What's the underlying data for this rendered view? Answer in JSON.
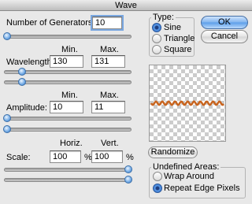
{
  "window": {
    "title": "Wave"
  },
  "generators": {
    "label": "Number of Generators:",
    "value": "10",
    "slider_level": 0.01
  },
  "wavelength": {
    "label": "Wavelength:",
    "min_header": "Min.",
    "max_header": "Max.",
    "min": "130",
    "max": "131",
    "min_slider": 0.13,
    "max_slider": 0.13
  },
  "amplitude": {
    "label": "Amplitude:",
    "min_header": "Min.",
    "max_header": "Max.",
    "min": "10",
    "max": "11",
    "min_slider": 0.01,
    "max_slider": 0.01
  },
  "scale": {
    "label": "Scale:",
    "horiz_header": "Horiz.",
    "vert_header": "Vert.",
    "horiz": "100",
    "vert": "100",
    "horiz_unit": "%",
    "vert_unit": "%",
    "horiz_slider": 1.0,
    "vert_slider": 1.0
  },
  "type": {
    "title": "Type:",
    "options": [
      "Sine",
      "Triangle",
      "Square"
    ],
    "selected": "Sine"
  },
  "buttons": {
    "ok": "OK",
    "cancel": "Cancel",
    "randomize": "Randomize"
  },
  "undefined_areas": {
    "title": "Undefined Areas:",
    "options": [
      "Wrap Around",
      "Repeat Edge Pixels"
    ],
    "selected": "Repeat Edge Pixels"
  },
  "colors": {
    "accent": "#3b79c4",
    "wave": "#c8641e"
  }
}
